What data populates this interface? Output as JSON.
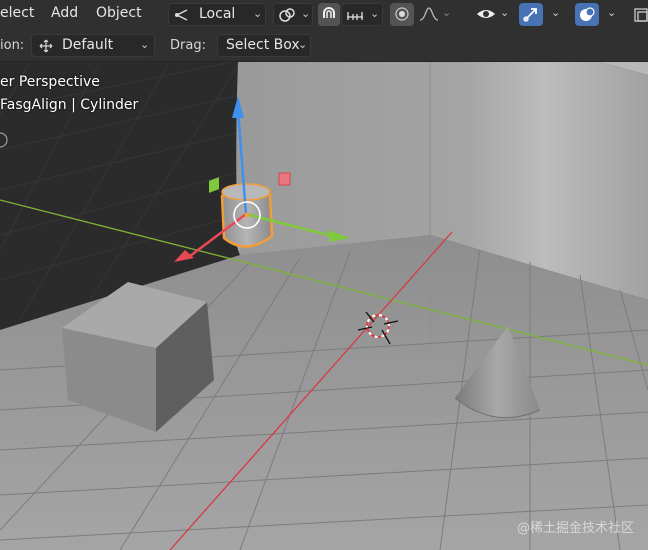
{
  "header": {
    "menu": {
      "select": "elect",
      "add": "Add",
      "object": "Object"
    },
    "orientation": {
      "value": "Local",
      "icon": "transform-orientation-icon"
    },
    "pivot_icon": "pivot-point-icon",
    "snap_icon": "snap-magnet-icon",
    "snap_target_icon": "snap-increment-icon",
    "proportional_icon": "proportional-editing-icon",
    "falloff_icon": "falloff-curve-icon",
    "visibility_icon": "eye-icon",
    "gizmo_icon": "gizmo-arrow-icon",
    "overlay_icon": "overlay-circles-icon"
  },
  "tool_header": {
    "orientation_label": "ion:",
    "orientation_value": "Default",
    "drag_label": "Drag:",
    "drag_value": "Select Box"
  },
  "viewport": {
    "view_name": "er Perspective",
    "object_info": "FasgAlign | Cylinder"
  },
  "watermark": "@稀土掘金技术社区",
  "colors": {
    "header_bg": "#303030",
    "accent_blue": "#4772b3",
    "selection_orange": "#f29d3a",
    "axis_x": "#d63a43",
    "axis_y": "#7fb437",
    "gizmo_z": "#3d8ff0"
  }
}
